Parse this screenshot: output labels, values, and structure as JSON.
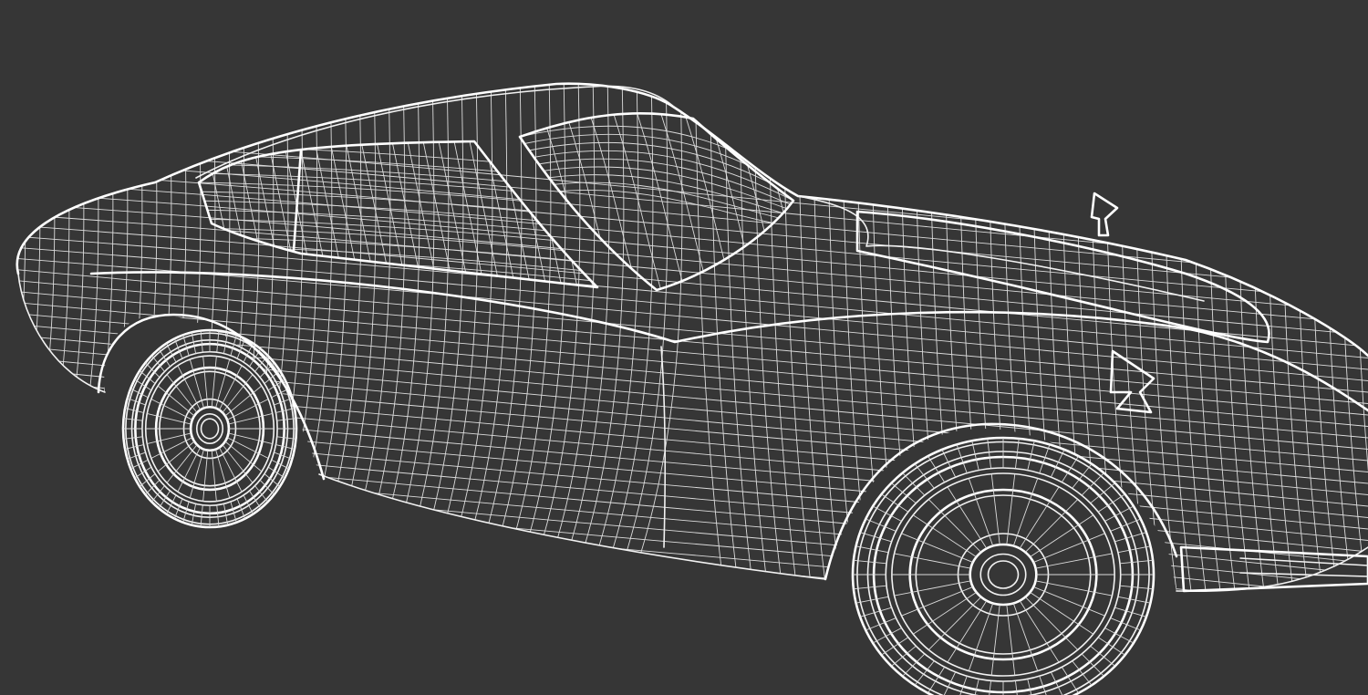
{
  "scene": {
    "background_color": "#363636",
    "wire_color": "#f2f2f2",
    "render_mode": "wireframe",
    "subject": "car-3d-model"
  }
}
